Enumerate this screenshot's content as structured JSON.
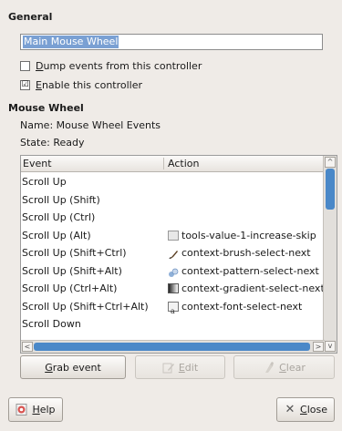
{
  "general": {
    "title": "General",
    "name_value": "Main Mouse Wheel",
    "dump_events": {
      "label": "Dump events from this controller",
      "mnemonic": "D",
      "rest": "ump events from this controller",
      "checked": false
    },
    "enable": {
      "label": "Enable this controller",
      "mnemonic": "E",
      "rest": "nable this controller",
      "checked": true
    }
  },
  "mouse_wheel": {
    "title": "Mouse Wheel",
    "name_line": "Name:  Mouse Wheel Events",
    "state_line": "State:  Ready"
  },
  "table": {
    "headers": {
      "event": "Event",
      "action": "Action"
    },
    "rows": [
      {
        "event": "Scroll Up",
        "action": "",
        "icon": ""
      },
      {
        "event": "Scroll Up (Shift)",
        "action": "",
        "icon": ""
      },
      {
        "event": "Scroll Up (Ctrl)",
        "action": "",
        "icon": ""
      },
      {
        "event": "Scroll Up (Alt)",
        "action": "tools-value-1-increase-skip",
        "icon": "tool-options-icon"
      },
      {
        "event": "Scroll Up (Shift+Ctrl)",
        "action": "context-brush-select-next",
        "icon": "paintbrush-icon"
      },
      {
        "event": "Scroll Up (Shift+Alt)",
        "action": "context-pattern-select-next",
        "icon": "pattern-icon"
      },
      {
        "event": "Scroll Up (Ctrl+Alt)",
        "action": "context-gradient-select-next",
        "icon": "gradient-icon"
      },
      {
        "event": "Scroll Up (Shift+Ctrl+Alt)",
        "action": "context-font-select-next",
        "icon": "font-icon"
      },
      {
        "event": "Scroll Down",
        "action": "",
        "icon": ""
      }
    ]
  },
  "buttons": {
    "grab": {
      "mnemonic": "G",
      "rest": "rab event"
    },
    "edit": {
      "mnemonic": "E",
      "rest": "dit"
    },
    "clear": {
      "mnemonic": "C",
      "rest": "lear"
    },
    "help": {
      "mnemonic": "H",
      "rest": "elp"
    },
    "close": {
      "mnemonic": "C",
      "rest": "lose"
    }
  },
  "colors": {
    "selection": "#7aa0d3",
    "scroll_thumb": "#4a88c8",
    "background": "#efebe7"
  }
}
